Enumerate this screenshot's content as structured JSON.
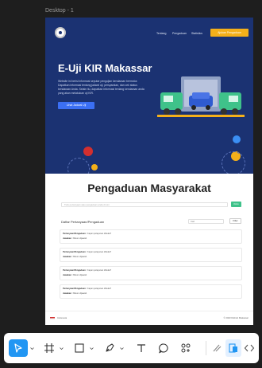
{
  "canvas": {
    "frame_label": "Desktop - 1"
  },
  "hero": {
    "nav": [
      "Tentang",
      "Pengaduan",
      "Statistics"
    ],
    "nav_cta": "Ajukan Pengaduan",
    "title": "E-Uji KIR Makassar",
    "description": "Website ini berisi informasi seputar pengujian kendaraan bermotor. Dapatkan informasi tentang jadwal uji, persyaratan, dan cek status kendaraan Anda. Selain itu, dapatkan informasi tentang kendaraan anda yang akan melakukan uji KIR.",
    "button": "Lihat Jadwal Uji",
    "colors": {
      "background": "#1b3272",
      "accent": "#f4b01a",
      "button": "#3b6ff4"
    }
  },
  "complaints": {
    "title": "Pengaduan Masyarakat",
    "search_placeholder": "Tulis pertanyaan atau pengaduan anda di sini",
    "search_button": "Kirim",
    "list_heading": "Daftar Pertanyaan/Pengaduan",
    "filter_placeholder": "Cari",
    "filter_button": "Filter",
    "items": [
      {
        "question_label": "Pertanyaan/Pengaduan :",
        "question": "Kapan pelayanan dibuka?",
        "answer_label": "Jawaban :",
        "answer": "Belum dijawab"
      },
      {
        "question_label": "Pertanyaan/Pengaduan :",
        "question": "Kapan pelayanan dibuka?",
        "answer_label": "Jawaban :",
        "answer": "Belum dijawab"
      },
      {
        "question_label": "Pertanyaan/Pengaduan :",
        "question": "Kapan pelayanan dibuka?",
        "answer_label": "Jawaban :",
        "answer": "Belum dijawab"
      },
      {
        "question_label": "Pertanyaan/Pengaduan :",
        "question": "Kapan pelayanan dibuka?",
        "answer_label": "Jawaban :",
        "answer": "Belum dijawab"
      }
    ]
  },
  "footer": {
    "left": "Indonesia",
    "right": "© 2023 Dishub Makassar"
  },
  "toolbar": {
    "tools": [
      "move-icon",
      "frame-icon",
      "rectangle-icon",
      "pen-icon",
      "text-icon",
      "comment-icon",
      "components-icon",
      "draw-icon",
      "dev-mode-icon",
      "code-icon"
    ],
    "active_tool": "move-icon",
    "accent": "#2196f3"
  }
}
